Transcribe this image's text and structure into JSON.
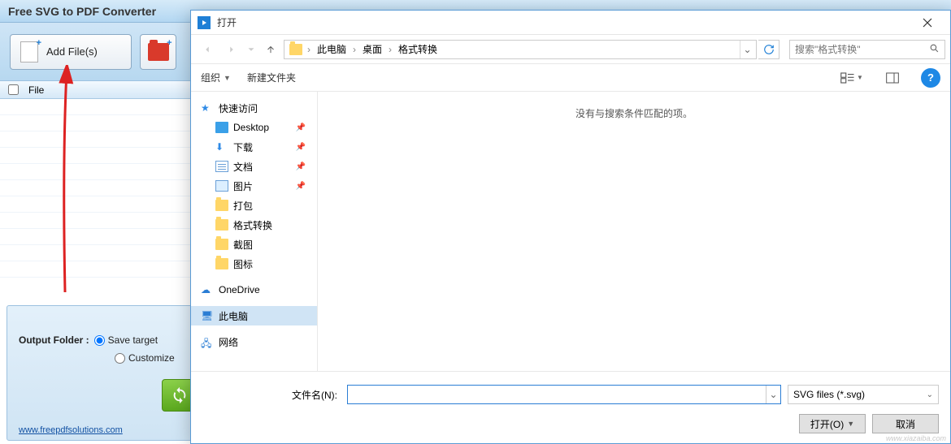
{
  "app": {
    "title": "Free SVG to PDF Converter",
    "add_files_label": "Add File(s)",
    "list_header": {
      "checkbox": false,
      "col_file": "File"
    },
    "output_folder_label": "Output Folder :",
    "opt_save_target": "Save target",
    "opt_customize": "Customize",
    "footer_link": "www.freepdfsolutions.com"
  },
  "dialog": {
    "title": "打开",
    "breadcrumb": {
      "root": "此电脑",
      "p1": "桌面",
      "p2": "格式转换"
    },
    "search_placeholder": "搜索\"格式转换\"",
    "toolbar": {
      "organize": "组织",
      "new_folder": "新建文件夹"
    },
    "tree": {
      "quick_access": "快速访问",
      "desktop": "Desktop",
      "downloads": "下载",
      "documents": "文档",
      "pictures": "图片",
      "f1": "打包",
      "f2": "格式转换",
      "f3": "截图",
      "f4": "图标",
      "onedrive": "OneDrive",
      "this_pc": "此电脑",
      "network": "网络"
    },
    "empty_msg": "没有与搜索条件匹配的项。",
    "filename_label": "文件名(N):",
    "filename_value": "",
    "filter": "SVG files (*.svg)",
    "btn_open": "打开(O)",
    "btn_cancel": "取消"
  },
  "watermark": "www.xiazaiba.com"
}
